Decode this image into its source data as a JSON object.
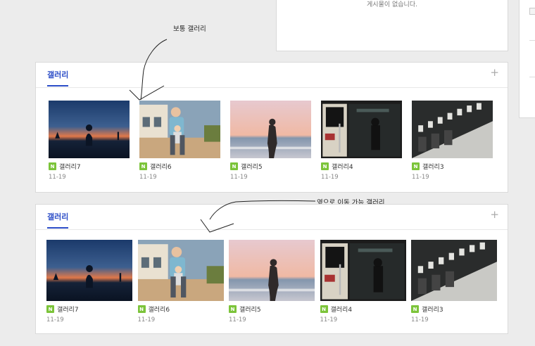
{
  "top_box": {
    "empty_text": "게시물이 없습니다."
  },
  "annotations": {
    "normal_gallery": "보통 갤러리",
    "slide_gallery": "옆으로 이동 가능 갤러리"
  },
  "panels": [
    {
      "title": "갤러리",
      "add_label": "+",
      "items": [
        {
          "badge": "N",
          "name": "갤러리7",
          "date": "11-19",
          "image": "sunset-silhouette-photo"
        },
        {
          "badge": "N",
          "name": "갤러리6",
          "date": "11-19",
          "image": "man-with-child-photo"
        },
        {
          "badge": "N",
          "name": "갤러리5",
          "date": "11-19",
          "image": "beach-woman-photo"
        },
        {
          "badge": "N",
          "name": "갤러리4",
          "date": "11-19",
          "image": "tram-doorway-photo"
        },
        {
          "badge": "N",
          "name": "갤러리3",
          "date": "11-19",
          "image": "building-shadows-photo"
        }
      ]
    },
    {
      "title": "갤러리",
      "add_label": "+",
      "items": [
        {
          "badge": "N",
          "name": "갤러리7",
          "date": "11-19",
          "image": "sunset-silhouette-photo"
        },
        {
          "badge": "N",
          "name": "갤러리6",
          "date": "11-19",
          "image": "man-with-child-photo"
        },
        {
          "badge": "N",
          "name": "갤러리5",
          "date": "11-19",
          "image": "beach-woman-photo"
        },
        {
          "badge": "N",
          "name": "갤러리4",
          "date": "11-19",
          "image": "tram-doorway-photo"
        },
        {
          "badge": "N",
          "name": "갤러리3",
          "date": "11-19",
          "image": "building-shadows-photo"
        }
      ]
    }
  ],
  "colors": {
    "accent": "#2b4cc7",
    "new_badge": "#7cc43a",
    "background": "#ececec"
  }
}
